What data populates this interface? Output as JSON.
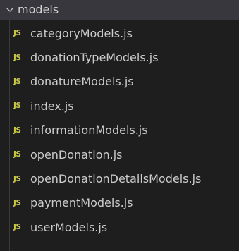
{
  "explorer": {
    "folder": {
      "name": "models",
      "icon": "chevron-down-icon",
      "expanded": true
    },
    "files": [
      {
        "name": "categoryModels.js",
        "icon": "js-file-icon",
        "icon_label": "JS"
      },
      {
        "name": "donationTypeModels.js",
        "icon": "js-file-icon",
        "icon_label": "JS"
      },
      {
        "name": "donatureModels.js",
        "icon": "js-file-icon",
        "icon_label": "JS"
      },
      {
        "name": "index.js",
        "icon": "js-file-icon",
        "icon_label": "JS"
      },
      {
        "name": "informationModels.js",
        "icon": "js-file-icon",
        "icon_label": "JS"
      },
      {
        "name": "openDonation.js",
        "icon": "js-file-icon",
        "icon_label": "JS"
      },
      {
        "name": "openDonationDetailsModels.js",
        "icon": "js-file-icon",
        "icon_label": "JS"
      },
      {
        "name": "paymentModels.js",
        "icon": "js-file-icon",
        "icon_label": "JS"
      },
      {
        "name": "userModels.js",
        "icon": "js-file-icon",
        "icon_label": "JS"
      }
    ]
  },
  "colors": {
    "background": "#1e1e1e",
    "folder_row_background": "#37373d",
    "text": "#cccccc",
    "js_icon": "#cbcb41"
  }
}
